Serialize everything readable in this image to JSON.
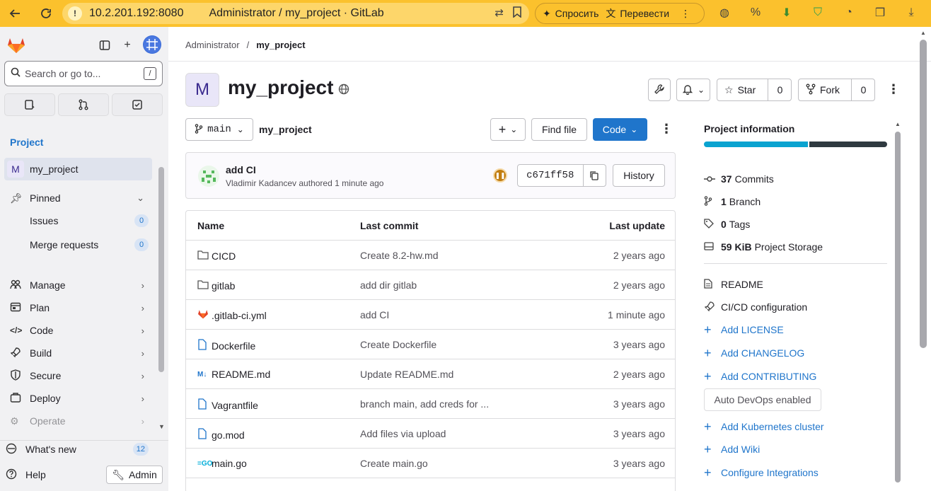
{
  "browser": {
    "url_host": "10.2.201.192:8080",
    "page_title": "Administrator / my_project · GitLab",
    "ai_ask": "Спросить",
    "ai_translate": "Перевести"
  },
  "sidebar": {
    "search_placeholder": "Search or go to...",
    "search_shortcut": "/",
    "section_title": "Project",
    "project_initial": "M",
    "project_name": "my_project",
    "pinned_label": "Pinned",
    "pinned_items": [
      {
        "label": "Issues",
        "count": "0"
      },
      {
        "label": "Merge requests",
        "count": "0"
      }
    ],
    "nav_items": [
      {
        "label": "Manage"
      },
      {
        "label": "Plan"
      },
      {
        "label": "Code"
      },
      {
        "label": "Build"
      },
      {
        "label": "Secure"
      },
      {
        "label": "Deploy"
      },
      {
        "label": "Operate"
      }
    ],
    "whats_new_label": "What's new",
    "whats_new_count": "12",
    "help_label": "Help",
    "admin_label": "Admin"
  },
  "breadcrumb": {
    "parent": "Administrator",
    "separator": "/",
    "current": "my_project"
  },
  "project": {
    "initial": "M",
    "title": "my_project",
    "star_label": "Star",
    "star_count": "0",
    "fork_label": "Fork",
    "fork_count": "0"
  },
  "repo_toolbar": {
    "branch": "main",
    "path": "my_project",
    "find_file": "Find file",
    "code_label": "Code"
  },
  "last_commit": {
    "title": "add CI",
    "meta": "Vladimir Kadancev authored 1 minute ago",
    "sha": "c671ff58",
    "history_label": "History",
    "pipeline_status": "paused"
  },
  "file_table": {
    "headers": {
      "name": "Name",
      "commit": "Last commit",
      "date": "Last update"
    },
    "rows": [
      {
        "icon": "folder-icon",
        "name": "CICD",
        "commit": "Create 8.2-hw.md",
        "date": "2 years ago"
      },
      {
        "icon": "folder-icon",
        "name": "gitlab",
        "commit": "add dir gitlab",
        "date": "2 years ago"
      },
      {
        "icon": "gitlab-ci-icon",
        "name": ".gitlab-ci.yml",
        "commit": "add CI",
        "date": "1 minute ago"
      },
      {
        "icon": "file-icon",
        "name": "Dockerfile",
        "commit": "Create Dockerfile",
        "date": "3 years ago"
      },
      {
        "icon": "markdown-icon",
        "name": "README.md",
        "commit": "Update README.md",
        "date": "2 years ago"
      },
      {
        "icon": "file-icon",
        "name": "Vagrantfile",
        "commit": "branch main, add creds for ...",
        "date": "3 years ago"
      },
      {
        "icon": "file-icon",
        "name": "go.mod",
        "commit": "Add files via upload",
        "date": "3 years ago"
      },
      {
        "icon": "go-icon",
        "name": "main.go",
        "commit": "Create main.go",
        "date": "3 years ago"
      }
    ]
  },
  "project_info": {
    "title": "Project information",
    "stats": [
      {
        "icon": "commit-icon",
        "value": "37",
        "label": "Commits"
      },
      {
        "icon": "branch-icon",
        "value": "1",
        "label": "Branch"
      },
      {
        "icon": "tag-icon",
        "value": "0",
        "label": "Tags"
      },
      {
        "icon": "storage-icon",
        "value": "59 KiB",
        "label": "Project Storage"
      }
    ],
    "links": [
      {
        "icon": "doc-icon",
        "label": "README",
        "style": "plain"
      },
      {
        "icon": "rocket-icon",
        "label": "CI/CD configuration",
        "style": "plain"
      },
      {
        "icon": "plus-icon",
        "label": "Add LICENSE",
        "style": "link"
      },
      {
        "icon": "plus-icon",
        "label": "Add CHANGELOG",
        "style": "link"
      },
      {
        "icon": "plus-icon",
        "label": "Add CONTRIBUTING",
        "style": "link"
      }
    ],
    "auto_devops": "Auto DevOps enabled",
    "links2": [
      {
        "icon": "plus-icon",
        "label": "Add Kubernetes cluster"
      },
      {
        "icon": "plus-icon",
        "label": "Add Wiki"
      },
      {
        "icon": "plus-icon",
        "label": "Configure Integrations"
      }
    ]
  },
  "colors": {
    "browser_bar": "#fbc12d",
    "accent": "#1f75cb",
    "sidebar_bg": "#f1f1f3",
    "lang_bar": [
      "#0aa3d0",
      "#2f3a40"
    ]
  }
}
